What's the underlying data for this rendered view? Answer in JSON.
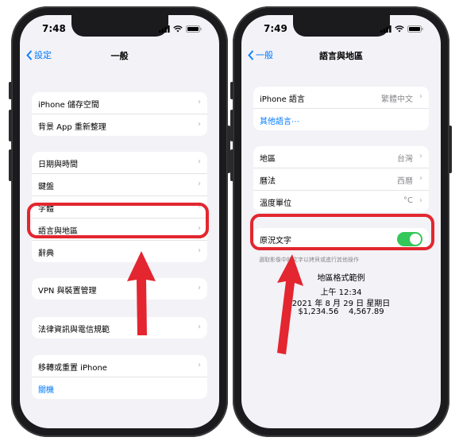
{
  "left": {
    "time": "7:48",
    "back_label": "設定",
    "title": "一般",
    "group1": [
      "iPhone 儲存空間",
      "背景 App 重新整理"
    ],
    "group2": [
      "日期與時間",
      "鍵盤",
      "字體",
      "語言與地區",
      "辭典"
    ],
    "group3": [
      "VPN 與裝置管理"
    ],
    "group4": [
      "法律資訊與電信規範"
    ],
    "group5": [
      "移轉或重置 iPhone",
      "關機"
    ]
  },
  "right": {
    "time": "7:49",
    "back_label": "一般",
    "title": "語言與地區",
    "group1": [
      {
        "label": "iPhone 語言",
        "value": "繁體中文"
      },
      {
        "label": "其他語言⋯",
        "value": ""
      }
    ],
    "group2": [
      {
        "label": "地區",
        "value": "台灣"
      },
      {
        "label": "曆法",
        "value": "西曆"
      },
      {
        "label": "溫度單位",
        "value": "°C"
      }
    ],
    "live_text": {
      "label": "原況文字",
      "enabled": true
    },
    "live_text_hint": "選取影像中的文字以拷貝或進行其他操作",
    "format": {
      "heading": "地區格式範例",
      "time": "上午 12:34",
      "date": "2021 年 8 月 29 日 星期日",
      "numbers": "$1,234.56    4,567.89"
    }
  },
  "colors": {
    "highlight": "#e3262f",
    "ios_blue": "#007aff",
    "toggle_on": "#34c759"
  }
}
